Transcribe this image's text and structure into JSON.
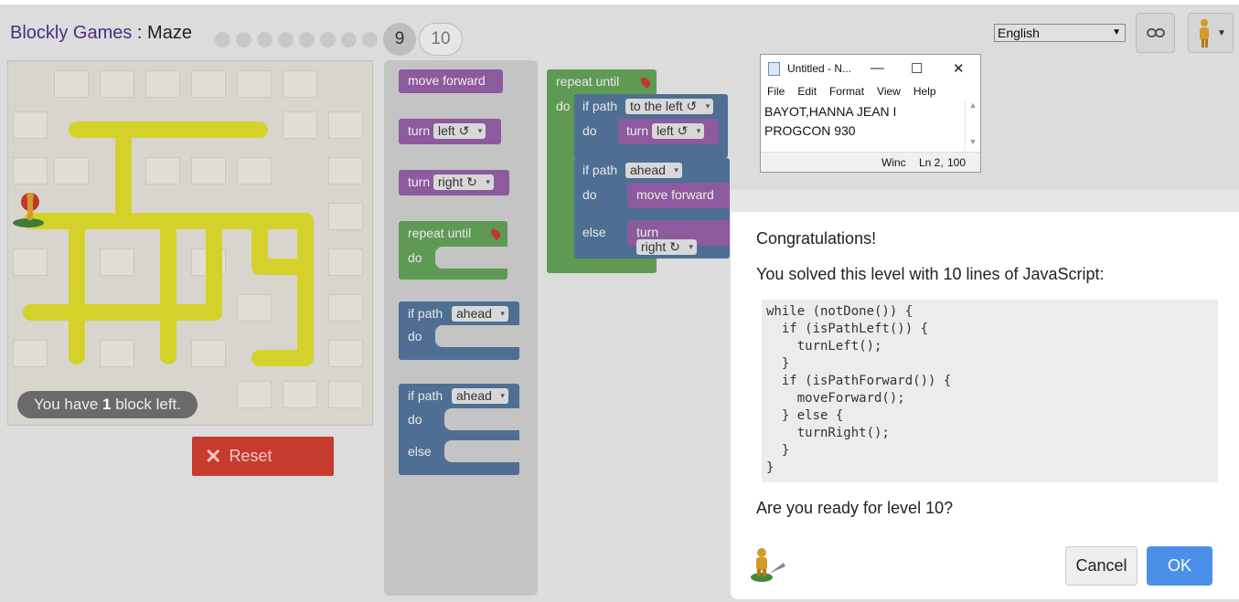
{
  "header": {
    "brand": "Blockly Games",
    "separator": " : ",
    "game": "Maze",
    "levels_done": 8,
    "current_level": "9",
    "next_level": "10",
    "language": "English",
    "link_icon": "link-icon",
    "avatar_icon": "pegman-icon"
  },
  "maze": {
    "status_prefix": "You have ",
    "blocks_left": "1",
    "status_suffix": " block left.",
    "reset_label": "Reset"
  },
  "toolbox": {
    "move_forward": "move forward",
    "turn": "turn",
    "left": "left ↺",
    "right": "right ↻",
    "repeat_until": "repeat until",
    "do": "do",
    "if_path": "if path",
    "ahead": "ahead",
    "else": "else"
  },
  "workspace": {
    "repeat_until": "repeat until",
    "do": "do",
    "if_path": "if path",
    "to_the_left": "to the left ↺",
    "turn": "turn",
    "left": "left ↺",
    "ahead": "ahead",
    "move_forward": "move forward",
    "else": "else",
    "right": "right ↻"
  },
  "notepad": {
    "title": "Untitled - N...",
    "minimize": "—",
    "maximize": "☐",
    "close": "✕",
    "menu": [
      "File",
      "Edit",
      "Format",
      "View",
      "Help"
    ],
    "line1": "BAYOT,HANNA JEAN I",
    "line2": "PROGCON 930",
    "status_encoding": "Winc",
    "status_pos": "Ln 2,",
    "status_zoom": "100"
  },
  "dialog": {
    "congrats": "Congratulations!",
    "solved": "You solved this level with 10 lines of JavaScript:",
    "code_lines": [
      "while (notDone()) {",
      "  if (isPathLeft()) {",
      "    turnLeft();",
      "  }",
      "  if (isPathForward()) {",
      "    moveForward();",
      "  } else {",
      "    turnRight();",
      "  }",
      "}"
    ],
    "question": "Are you ready for level 10?",
    "cancel": "Cancel",
    "ok": "OK"
  },
  "colors": {
    "brand": "#4b2e83",
    "ok_button": "#4a90e8",
    "reset_button": "#c73a2e",
    "block_purple": "#8d5a9d",
    "block_green": "#5e9a54",
    "block_blue": "#4e6f93",
    "road": "#d4d22a"
  }
}
